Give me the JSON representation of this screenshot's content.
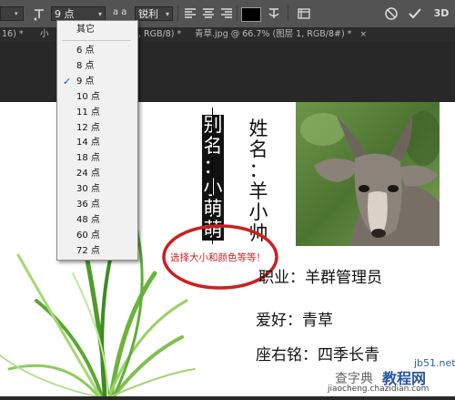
{
  "options_bar": {
    "font_size_value": "9 点",
    "aa_label": "a a",
    "antialias_value": "锐利"
  },
  "tabs": [
    {
      "label": "16) *"
    },
    {
      "label": "小",
      "close": "×"
    },
    {
      "label": ", RGB/8) *"
    },
    {
      "label": "青草.jpg @ 66.7% (图层 1, RGB/8#) *",
      "close": "×"
    }
  ],
  "font_size_menu": {
    "other": "其它",
    "items": [
      "6 点",
      "8 点",
      "9 点",
      "10 点",
      "11 点",
      "12 点",
      "14 点",
      "18 点",
      "24 点",
      "30 点",
      "36 点",
      "48 点",
      "60 点",
      "72 点"
    ],
    "selected": "9 点"
  },
  "canvas": {
    "nickname_chars": [
      "别",
      "名",
      "：",
      "小",
      "萌",
      "萌"
    ],
    "name_chars": [
      "姓",
      "名",
      "：",
      "羊",
      "小",
      "帅"
    ],
    "annotation": "选择大小和颜色等等！",
    "job": "职业：羊群管理员",
    "hobby": "爱好：青草",
    "motto": "座右铭：四季长青"
  },
  "watermark": {
    "line1": "jb51.net",
    "line2": "教程网",
    "line3": "jiaocheng.chazidian.com",
    "line4": "查字典"
  },
  "colors": {
    "annotation_red": "#cc1f1f",
    "check_blue": "#1a4fa8"
  }
}
